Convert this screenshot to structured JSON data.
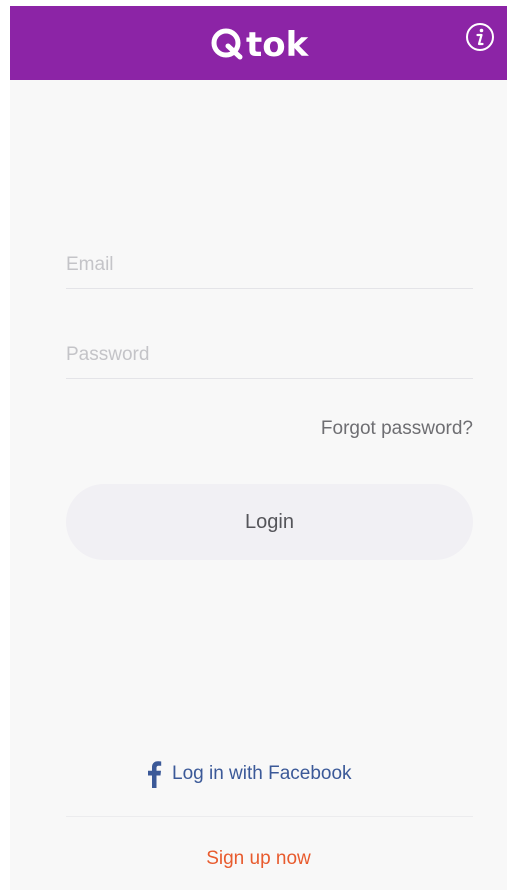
{
  "header": {
    "logo_text": "tok",
    "background_color": "#8c24a6",
    "info_icon": "info-icon"
  },
  "form": {
    "email_placeholder": "Email",
    "email_value": "",
    "password_placeholder": "Password",
    "password_value": "",
    "forgot_label": "Forgot password?",
    "login_label": "Login"
  },
  "social": {
    "facebook_icon": "facebook-icon",
    "facebook_label": "Log in with Facebook",
    "facebook_color": "#3b5998"
  },
  "footer": {
    "signup_label": "Sign up now",
    "signup_color": "#e85b2e"
  }
}
